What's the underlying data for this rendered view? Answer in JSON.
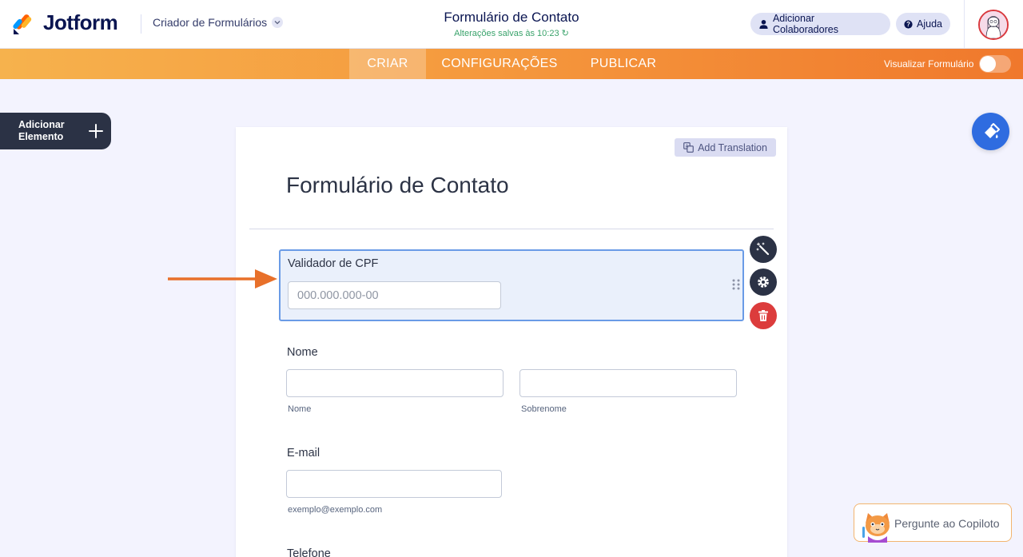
{
  "header": {
    "logo_text": "Jotform",
    "builder_menu": "Criador de Formulários",
    "form_title": "Formulário de Contato",
    "save_status": "Alterações salvas às 10:23",
    "add_collaborators": "Adicionar Colaboradores",
    "help": "Ajuda"
  },
  "nav": {
    "tabs": [
      {
        "label": "CRIAR",
        "active": true
      },
      {
        "label": "CONFIGURAÇÕES",
        "active": false
      },
      {
        "label": "PUBLICAR",
        "active": false
      }
    ],
    "preview_label": "Visualizar Formulário",
    "preview_on": false
  },
  "sidebar": {
    "add_element_label": "Adicionar Elemento"
  },
  "form": {
    "add_translation": "Add Translation",
    "heading": "Formulário de Contato",
    "fields": {
      "cpf": {
        "label": "Validador de CPF",
        "placeholder": "000.000.000-00"
      },
      "name": {
        "label": "Nome",
        "first_sublabel": "Nome",
        "last_sublabel": "Sobrenome"
      },
      "email": {
        "label": "E-mail",
        "sublabel": "exemplo@exemplo.com"
      },
      "phone": {
        "label": "Telefone"
      }
    }
  },
  "copilot": {
    "label": "Pergunte ao Copiloto"
  },
  "colors": {
    "brand_dark": "#0a1551",
    "orange_start": "#f6b24d",
    "orange_end": "#f0782c",
    "selected_border": "#6a9be6",
    "delete_red": "#dc3c3c",
    "theme_blue": "#2f6ce0",
    "arrow_orange": "#e8702a"
  }
}
